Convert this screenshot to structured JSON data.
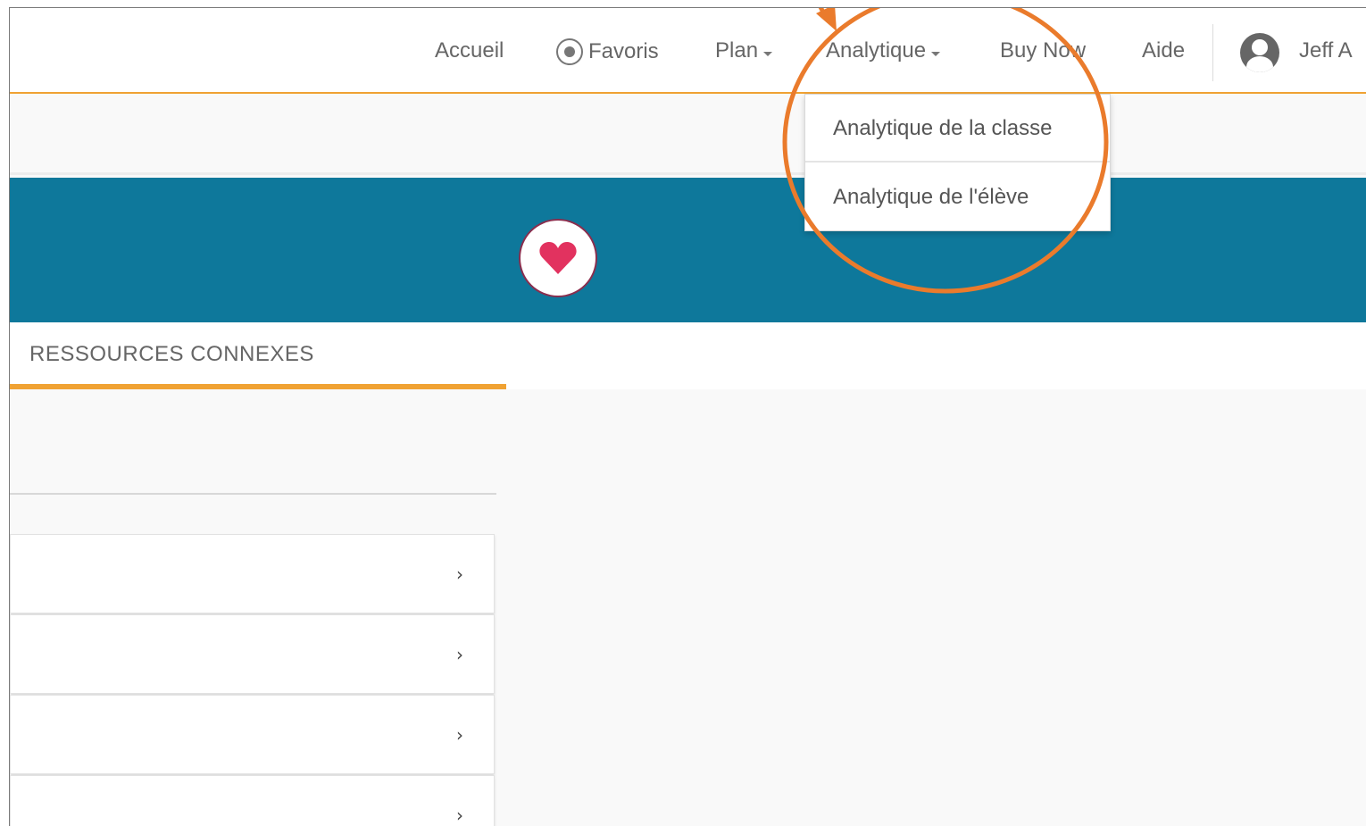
{
  "nav": {
    "items": [
      {
        "label": "Accueil"
      },
      {
        "label": "Favoris"
      },
      {
        "label": "Plan"
      },
      {
        "label": "Analytique"
      },
      {
        "label": "Buy Now"
      },
      {
        "label": "Aide"
      }
    ],
    "user_name": "Jeff A"
  },
  "analytics_menu": {
    "items": [
      {
        "label": "Analytique de la classe"
      },
      {
        "label": "Analytique de l'élève"
      }
    ]
  },
  "tabs": {
    "related_resources": "RESSOURCES CONNEXES"
  },
  "list": {
    "chevron": "›",
    "count": 4
  },
  "colors": {
    "accent_orange": "#f0a233",
    "banner_teal": "#0e789b",
    "annotation_orange": "#ea7b2c",
    "heart_red": "#e2325f"
  },
  "icons": {
    "favorites": "heart-circle-icon",
    "user": "user-circle-icon",
    "banner": "heart-icon"
  }
}
